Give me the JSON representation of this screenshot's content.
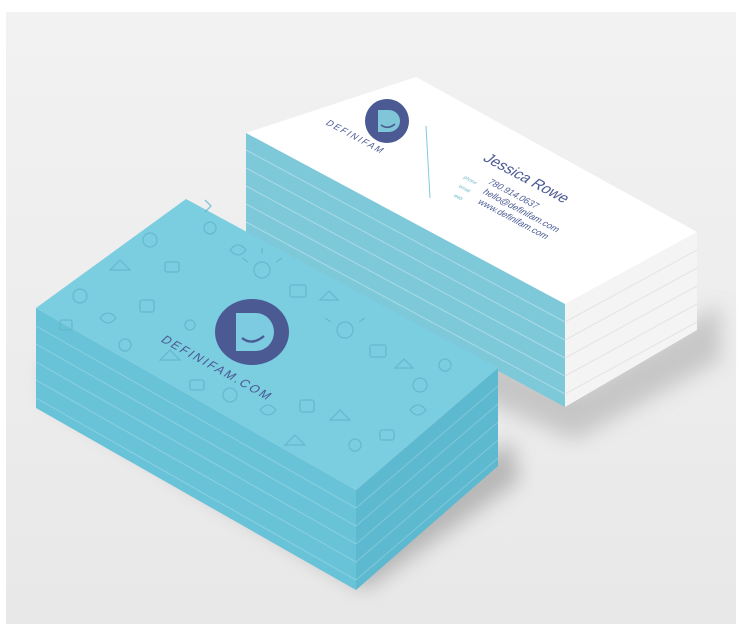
{
  "back_card": {
    "brand": "DEFINIFAM",
    "name": "Jessica Rowe",
    "labels": [
      "phone",
      "email",
      "web"
    ],
    "phone": "780.914.0637",
    "email": "hello@definifam.com",
    "web": "www.definifam.com"
  },
  "front_card": {
    "url_text": "DEFINIFAM.COM"
  },
  "colors": {
    "brand_navy": "#4b5a93",
    "card_blue": "#72c8dc",
    "card_white": "#ffffff",
    "background": "#efefef"
  }
}
